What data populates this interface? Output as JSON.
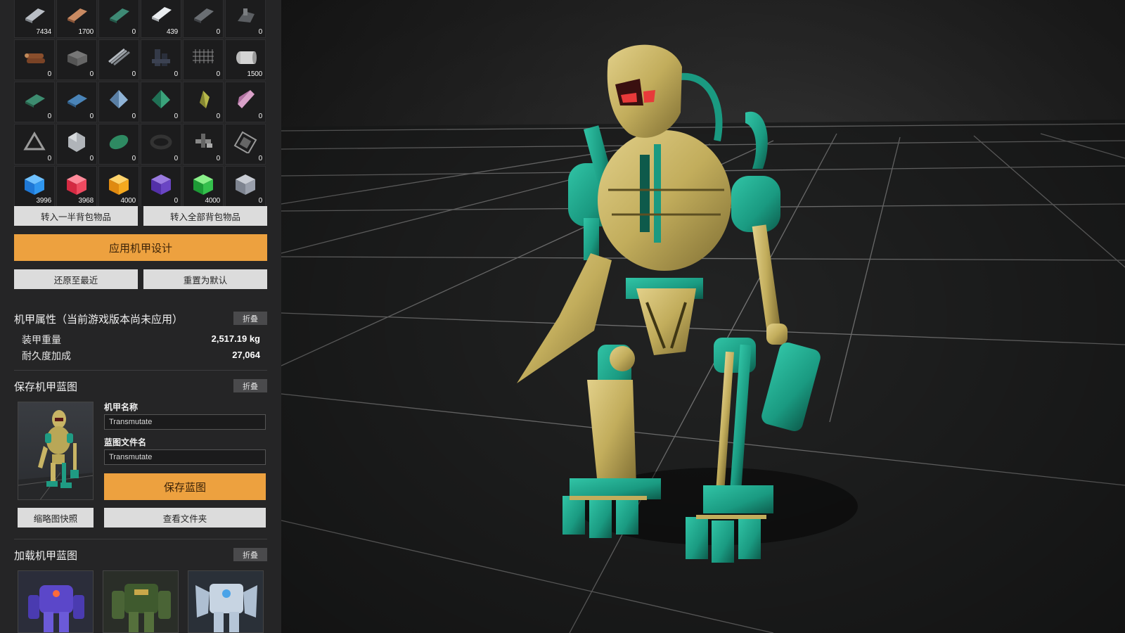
{
  "inventory": {
    "rows": [
      [
        {
          "icon": "steel-plate-icon",
          "count": "7434"
        },
        {
          "icon": "copper-plate-icon",
          "count": "1700"
        },
        {
          "icon": "green-plate-icon",
          "count": "0"
        },
        {
          "icon": "silver-plate-icon",
          "count": "439"
        },
        {
          "icon": "dark-plate-icon",
          "count": "0"
        },
        {
          "icon": "scrap-icon",
          "count": "0"
        }
      ],
      [
        {
          "icon": "wood-logs-icon",
          "count": "0"
        },
        {
          "icon": "stone-block-icon",
          "count": "0"
        },
        {
          "icon": "metal-rods-icon",
          "count": "0"
        },
        {
          "icon": "dark-beams-icon",
          "count": "0"
        },
        {
          "icon": "mesh-icon",
          "count": "0"
        },
        {
          "icon": "mesh-roll-icon",
          "count": "1500"
        }
      ],
      [
        {
          "icon": "green-tile-icon",
          "count": "0"
        },
        {
          "icon": "blue-tile-icon",
          "count": "0"
        },
        {
          "icon": "blue-crystal-icon",
          "count": "0"
        },
        {
          "icon": "green-crystal-icon",
          "count": "0"
        },
        {
          "icon": "yellow-gem-icon",
          "count": "0"
        },
        {
          "icon": "pink-crystal-icon",
          "count": "0"
        }
      ],
      [
        {
          "icon": "grey-prism-icon",
          "count": "0"
        },
        {
          "icon": "hexagon-icon",
          "count": "0"
        },
        {
          "icon": "green-leaf-icon",
          "count": "0"
        },
        {
          "icon": "ring-icon",
          "count": "0"
        },
        {
          "icon": "machine-part-icon",
          "count": "0"
        },
        {
          "icon": "chip-icon",
          "count": "0"
        }
      ],
      [
        {
          "icon": "blue-cube-icon",
          "count": "3996"
        },
        {
          "icon": "red-cube-icon",
          "count": "3968"
        },
        {
          "icon": "orange-cube-icon",
          "count": "4000"
        },
        {
          "icon": "purple-cube-icon",
          "count": "0"
        },
        {
          "icon": "green-cube-icon",
          "count": "4000"
        },
        {
          "icon": "grey-cube-icon",
          "count": "0"
        }
      ]
    ]
  },
  "actions": {
    "transfer_half": "转入一半背包物品",
    "transfer_all": "转入全部背包物品",
    "apply_design": "应用机甲设计",
    "restore_recent": "还原至最近",
    "reset_default": "重置为默认"
  },
  "properties": {
    "title": "机甲属性（当前游戏版本尚未应用）",
    "fold": "折叠",
    "stats": [
      {
        "label": "装甲重量",
        "value": "2,517.19 kg"
      },
      {
        "label": "耐久度加成",
        "value": "27,064"
      }
    ]
  },
  "save_blueprint": {
    "title": "保存机甲蓝图",
    "fold": "折叠",
    "mech_name_label": "机甲名称",
    "mech_name_value": "Transmutate",
    "file_name_label": "蓝图文件名",
    "file_name_value": "Transmutate",
    "save_button": "保存蓝图",
    "thumbnail_button": "缩略图快照",
    "view_folder_button": "查看文件夹"
  },
  "load_blueprint": {
    "title": "加载机甲蓝图",
    "fold": "折叠"
  },
  "colors": {
    "panel_bg": "#252526",
    "accent_orange": "#eda13f",
    "button_grey": "#dcdcdc",
    "mech_gold": "#c8b465",
    "mech_teal": "#1f9b83"
  }
}
